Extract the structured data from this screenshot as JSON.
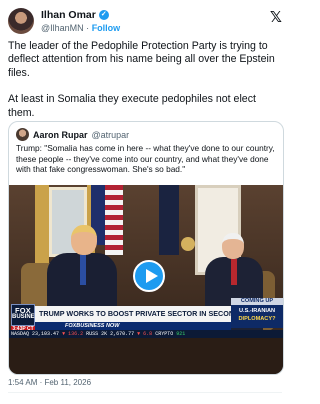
{
  "author": {
    "name": "Ilhan Omar",
    "handle": "@IlhanMN",
    "separator": "·",
    "follow_label": "Follow"
  },
  "tweet": {
    "paragraphs": [
      "The leader of the Pedophile Protection Party is trying to deflect attention from his name being all over the Epstein files.",
      "At least in Somalia they execute pedophiles not elect them."
    ]
  },
  "quote": {
    "name": "Aaron Rupar",
    "handle": "@atrupar",
    "text": "Trump: \"Somalia has come in here -- what they've done to our country, these people -- they've come into our country, and what they've done with that fake congresswoman. She's so bad.\""
  },
  "video": {
    "network_logo_line1": "FOX",
    "network_logo_line2": "BUSINESS",
    "lower_third": "TRUMP WORKS TO BOOST PRIVATE SECTOR IN SECOND TERM",
    "coming_up_label": "COMING UP",
    "coming_up_line1": "U.S.-IRANIAN",
    "coming_up_line2": "DIPLOMACY?",
    "clock": "3:43P CT",
    "fbn_bar": "FOXBUSINESS NOW",
    "ticker": {
      "label1": "NASDAQ",
      "value1": "23,103.47",
      "change1": "▼ 136.2",
      "label2": "RUSS 2K",
      "value2": "2,670.77",
      "change2": "▼ 6.8",
      "label3": "CRYPTO",
      "value3": "921"
    },
    "play_button": "play"
  },
  "timestamp": "1:54 AM · Feb 11, 2026"
}
